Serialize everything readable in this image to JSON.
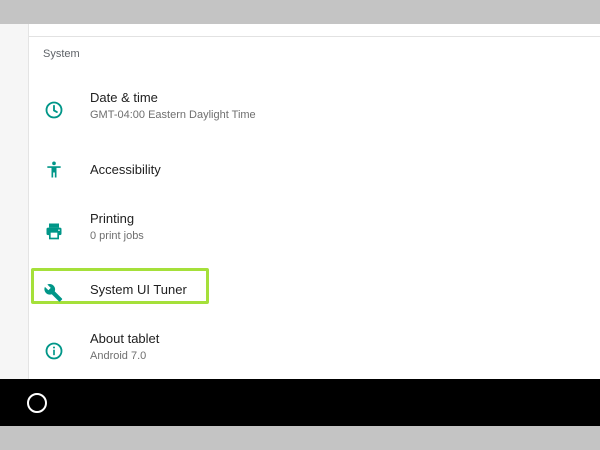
{
  "section": {
    "title": "System"
  },
  "items": [
    {
      "title": "Date & time",
      "subtitle": "GMT-04:00 Eastern Daylight Time",
      "icon": "clock-icon"
    },
    {
      "title": "Accessibility",
      "icon": "accessibility-icon"
    },
    {
      "title": "Printing",
      "subtitle": "0 print jobs",
      "icon": "printer-icon"
    },
    {
      "title": "System UI Tuner",
      "icon": "wrench-icon",
      "highlighted": true
    },
    {
      "title": "About tablet",
      "subtitle": "Android 7.0",
      "icon": "info-icon"
    }
  ],
  "colors": {
    "accent": "#009688",
    "highlight": "#a5e03a",
    "navbar": "#000000"
  }
}
